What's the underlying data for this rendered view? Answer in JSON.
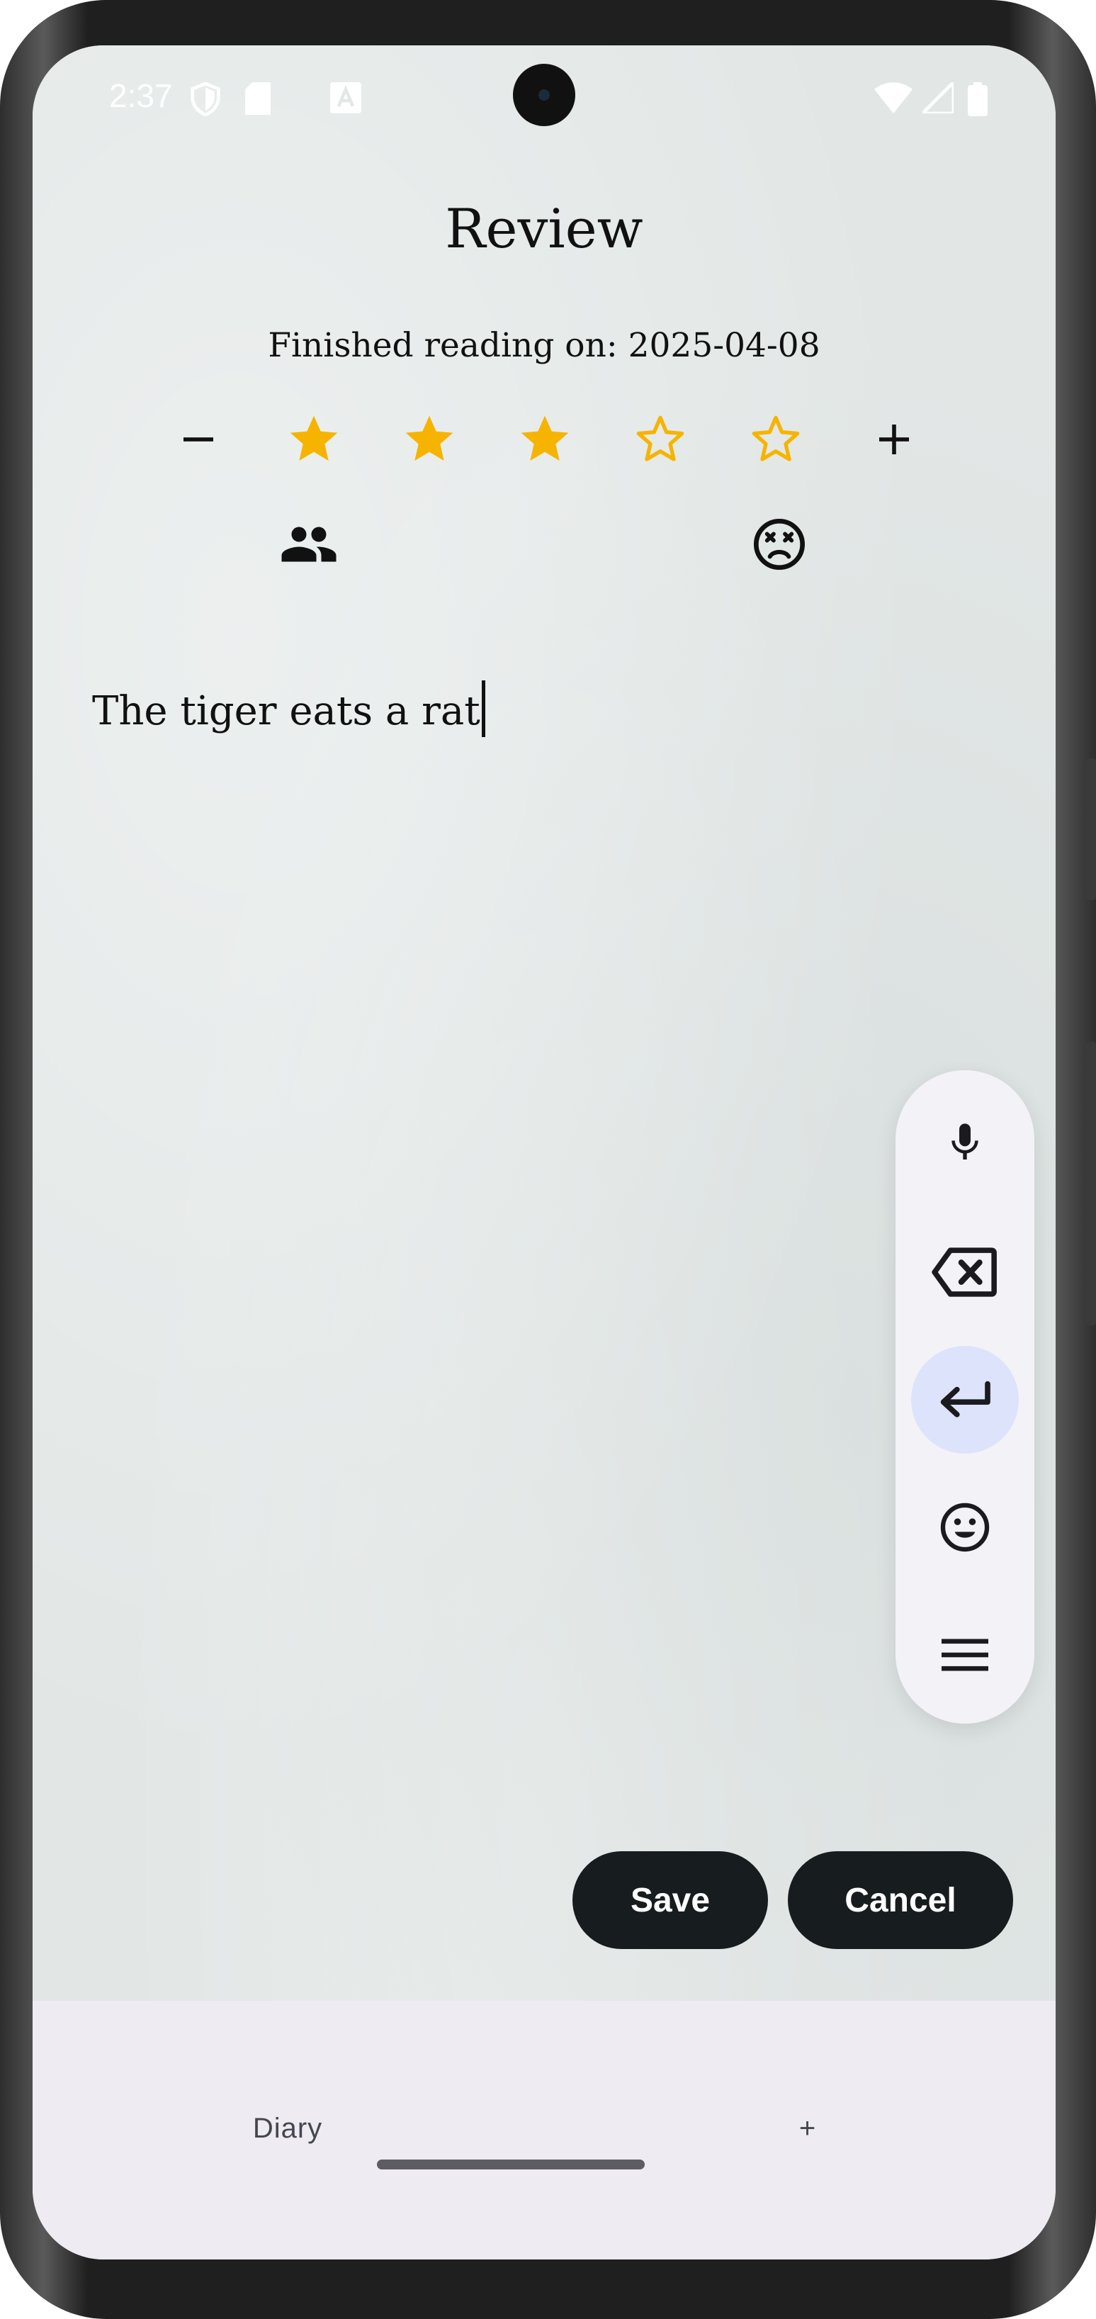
{
  "status_bar": {
    "time": "2:37",
    "icons": [
      "shield-icon",
      "sd-card-icon",
      "keyboard-a-icon",
      "wifi-icon",
      "signal-icon",
      "battery-icon"
    ]
  },
  "header": {
    "title": "Review"
  },
  "reading": {
    "finished_text": "Finished reading on: 2025-04-08"
  },
  "rating": {
    "value": 3,
    "max": 5,
    "decrease_icon": "minus-icon",
    "increase_icon": "plus-icon",
    "star_color": "#f6b400"
  },
  "mood": {
    "left_icon": "people-icon",
    "right_icon": "dizzy-face-icon"
  },
  "review": {
    "text": "The tiger eats a rat"
  },
  "keyboard_toolbar": {
    "buttons": [
      "microphone-icon",
      "backspace-icon",
      "enter-icon",
      "emoji-icon",
      "menu-icon"
    ],
    "active": "enter-icon",
    "active_color": "#dde3fb"
  },
  "actions": {
    "save_label": "Save",
    "cancel_label": "Cancel"
  },
  "bottom_nav": {
    "diary_label": "Diary",
    "add_label": "+"
  }
}
